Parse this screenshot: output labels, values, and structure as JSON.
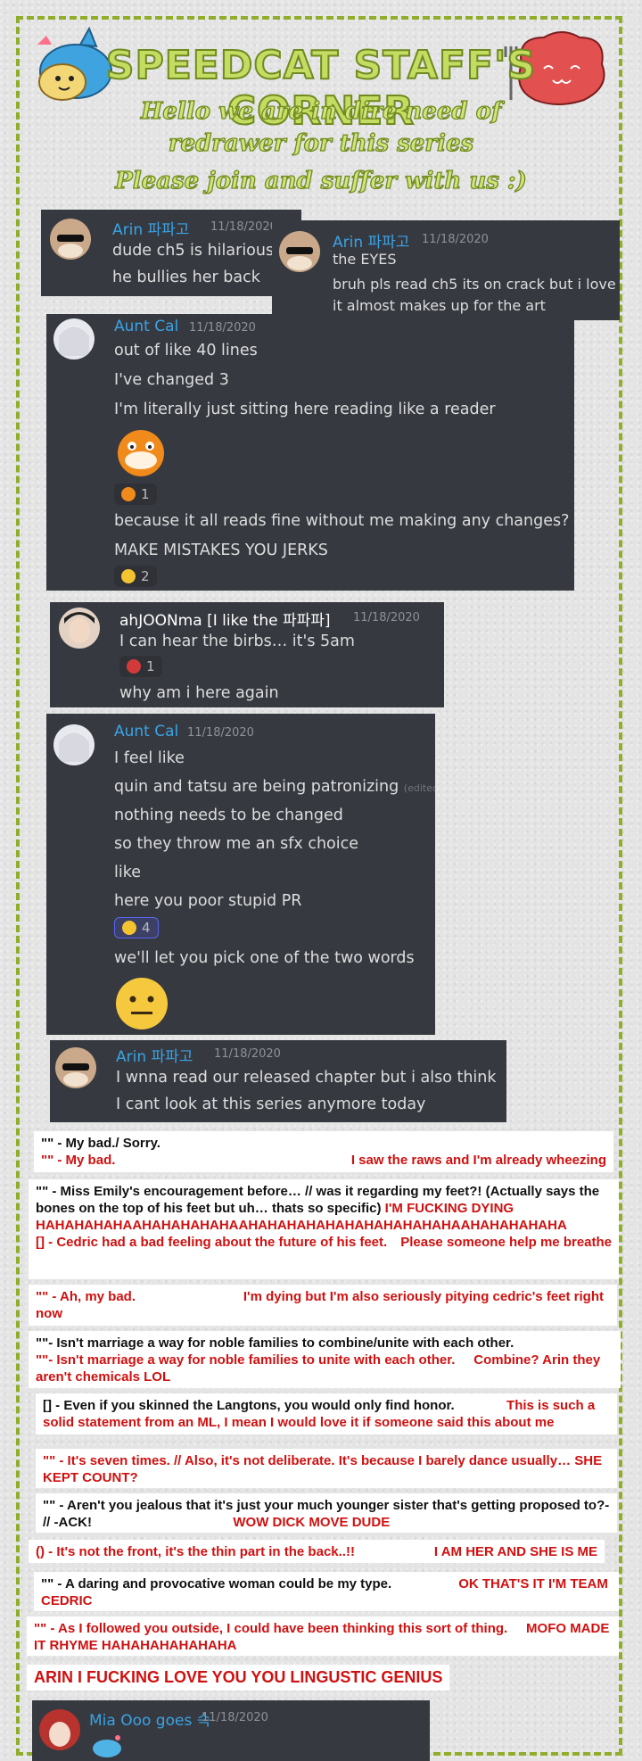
{
  "header": {
    "title": "SPEEDCAT STAFF'S CORNER",
    "line1": "Hello we are in dire need of",
    "line2": "redrawer for this series",
    "line3": "Please join and suffer with us :)"
  },
  "messages": [
    {
      "user": "Arin 파파고",
      "ts": "11/18/2020",
      "lines": [
        "dude ch5 is hilarious",
        "he bullies her back"
      ]
    },
    {
      "user": "Arin 파파고",
      "ts": "11/18/2020",
      "lines": [
        "the EYES",
        "bruh pls read ch5 its on crack but i love it",
        "it almost makes up for the art"
      ]
    },
    {
      "user": "Aunt Cal",
      "ts": "11/18/2020",
      "lines": [
        "out of like 40 lines",
        "I've changed 3",
        "I'm literally just sitting here reading like a reader",
        "because it all reads fine without me making any changes?",
        "MAKE MISTAKES YOU JERKS"
      ],
      "reactions": [
        "1",
        "2"
      ]
    },
    {
      "user": "ahJOONma [I like the 파파파]",
      "ts": "11/18/2020",
      "lines": [
        "I can hear the birbs… it's 5am",
        "why am i here again"
      ],
      "reactions": [
        "1"
      ]
    },
    {
      "user": "Aunt Cal",
      "ts": "11/18/2020",
      "lines": [
        "I feel like",
        "quin and tatsu are being patronizing",
        "nothing needs to be changed",
        "so they throw me an sfx choice",
        "like",
        "here you poor stupid PR",
        "we'll let you pick one of the two words"
      ],
      "edited": "(edited)",
      "reactions": [
        "4"
      ]
    },
    {
      "user": "Arin 파파고",
      "ts": "11/18/2020",
      "lines": [
        "I wnna read our released chapter but i also think",
        "I cant look at this series anymore today"
      ]
    },
    {
      "user": "Mia Ooo goes 슥",
      "ts": "11/18/2020"
    }
  ],
  "translations": [
    {
      "a": "\"\" - My bad./ Sorry.",
      "b": "\"\" - My bad.",
      "c": "I saw the raws and I'm already wheezing"
    },
    {
      "a": "\"\" - Miss Emily's encouragement before… // was it regarding my feet?! (Actually says the bones on the top of his feet but uh… thats so specific)",
      "a2": " I'M FUCKING DYING HAHAHAHAHAAHAHAHAHAHAAHAHAHAHAHAHAHAHAHAHAHAAHAHAHAHAHA",
      "b": "[] - Cedric had a bad feeling about the future of his feet.",
      "c": "Please someone help me breathe"
    },
    {
      "b": "\"\" - Ah, my bad.",
      "c": "I'm dying but I'm also seriously pitying cedric's feet right now"
    },
    {
      "a": "\"\"- Isn't marriage a way for noble families to combine/unite with each other.",
      "b": "\"\"- Isn't marriage a way for noble families to unite with each other.",
      "c": "Combine? Arin they aren't chemicals LOL"
    },
    {
      "a": "[] - Even if you skinned the Langtons, you would only find honor.",
      "c": "This is such a solid statement from an ML, I mean I would love it if someone said this about me"
    },
    {
      "b": "\"\" - It's seven times. // Also, it's not deliberate. It's because I barely dance usually…",
      "c": "SHE KEPT COUNT?"
    },
    {
      "a": "\"\" - Aren't you jealous that it's just your much younger sister that's getting proposed to?- // -ACK!",
      "c": "WOW DICK MOVE DUDE"
    },
    {
      "b": "() - It's not the front, it's the thin part in the back..!!",
      "c": "I AM HER AND SHE IS ME"
    },
    {
      "a": "\"\" - A daring and provocative woman could be my type.",
      "c": "OK THAT'S IT I'M TEAM CEDRIC"
    },
    {
      "b": "\"\" - As I followed you outside, I could have been thinking this sort of thing.",
      "c": "MOFO MADE IT RHYME HAHAHAHAHAHAHA"
    }
  ],
  "footer": "ARIN I FUCKING LOVE YOU YOU LINGUSTIC GENIUS",
  "colors": {
    "discord_bg": "#36393f",
    "username_blue": "#3aa3e6",
    "border_green": "#8fae2a",
    "red_text": "#d01010"
  }
}
